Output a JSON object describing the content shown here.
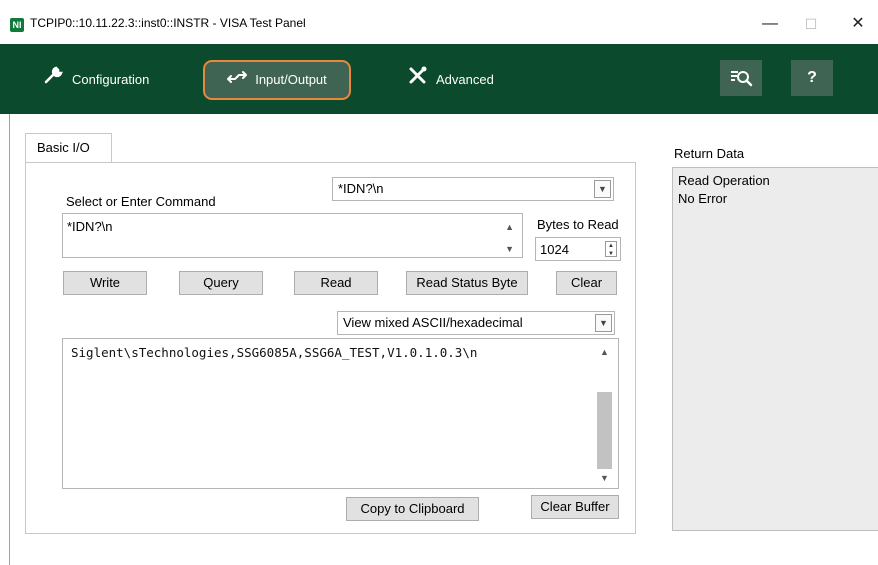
{
  "window": {
    "title": "TCPIP0::10.11.22.3::inst0::INSTR - VISA Test Panel",
    "app_icon_text": "NI",
    "minimize_glyph": "—",
    "maximize_glyph": "☐",
    "close_glyph": "✕"
  },
  "toolbar": {
    "configuration_label": "Configuration",
    "io_label": "Input/Output",
    "advanced_label": "Advanced",
    "help_label": "?",
    "accent_color": "#e9883b",
    "background_color": "#0b4a2c"
  },
  "tabs": {
    "basic_io_label": "Basic I/O"
  },
  "command": {
    "label": "Select or Enter Command",
    "combo_value": "*IDN?\\n",
    "text_value": "*IDN?\\n"
  },
  "bytes": {
    "label": "Bytes to Read",
    "value": "1024"
  },
  "buttons": {
    "write": "Write",
    "query": "Query",
    "read": "Read",
    "read_status_byte": "Read Status Byte",
    "clear": "Clear",
    "copy_to_clipboard": "Copy to Clipboard",
    "clear_buffer": "Clear Buffer"
  },
  "view_mode": {
    "value": "View mixed ASCII/hexadecimal"
  },
  "output": {
    "text": "Siglent\\sTechnologies,SSG6085A,SSG6A_TEST,V1.0.1.0.3\\n"
  },
  "return_data": {
    "label": "Return Data",
    "lines": [
      "Read Operation",
      "No Error"
    ]
  }
}
